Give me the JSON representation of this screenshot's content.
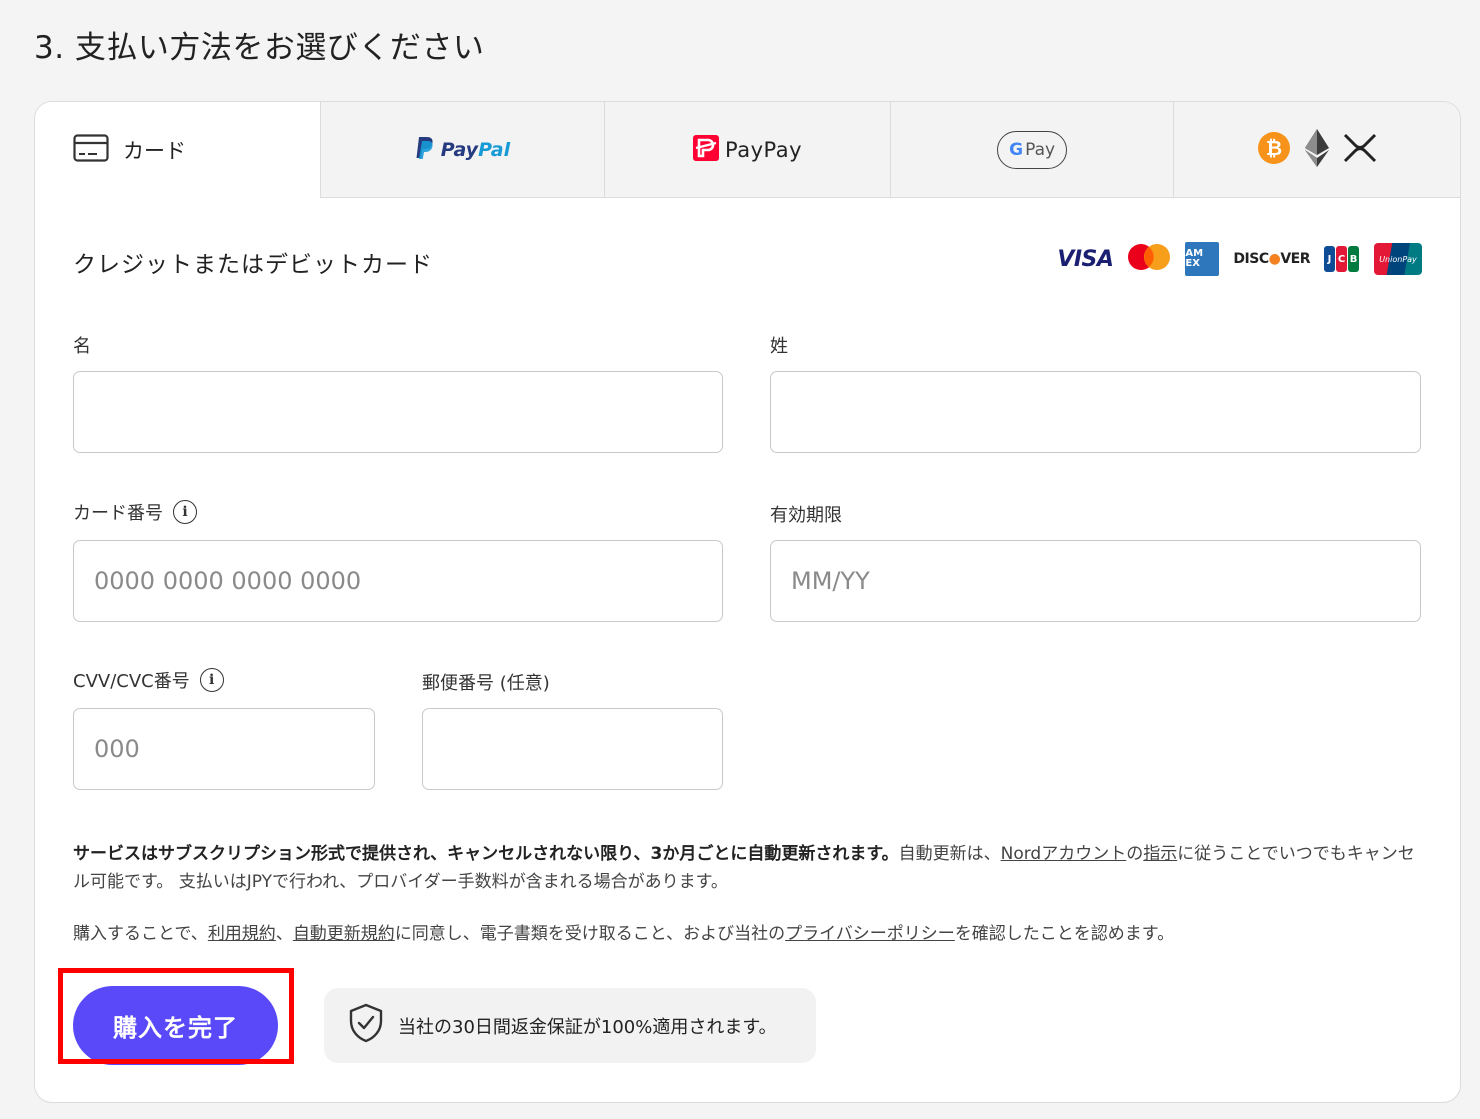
{
  "page": {
    "step_title": "3. 支払い方法をお選びください"
  },
  "tabs": {
    "card": {
      "label": "カード"
    },
    "paypal": {
      "label_a": "Pay",
      "label_b": "Pal"
    },
    "paypay": {
      "label": "PayPay"
    },
    "googlepay": {
      "g": "G",
      "label": "Pay"
    }
  },
  "card_section": {
    "title": "クレジットまたはデビットカード",
    "brands": {
      "visa": "VISA",
      "amex": "AM EX",
      "discover_a": "DISC",
      "discover_b": "VER",
      "jcb": [
        "J",
        "C",
        "B"
      ],
      "unionpay": "UnionPay"
    },
    "fields": {
      "first_name": {
        "label": "名",
        "value": "",
        "placeholder": ""
      },
      "last_name": {
        "label": "姓",
        "value": "",
        "placeholder": ""
      },
      "card_number": {
        "label": "カード番号",
        "placeholder": "0000 0000 0000 0000"
      },
      "expiry": {
        "label": "有効期限",
        "placeholder": "MM/YY"
      },
      "cvv": {
        "label": "CVV/CVC番号",
        "placeholder": "000"
      },
      "postal": {
        "label": "郵便番号 (任意)",
        "placeholder": ""
      }
    }
  },
  "terms": {
    "bold": "サービスはサブスクリプション形式で提供され、キャンセルされない限り、3か月ごとに自動更新されます。",
    "t1": "自動更新は、",
    "link_account": "Nordアカウント",
    "t2": "の",
    "link_instructions": "指示",
    "t3": "に従うことでいつでもキャンセル可能です。 支払いはJPYで行われ、プロバイダー手数料が含まれる場合があります。"
  },
  "consent": {
    "t1": "購入することで、",
    "link_terms": "利用規約",
    "t2": "、",
    "link_renewal": "自動更新規約",
    "t3": "に同意し、電子書類を受け取ること、および当社の",
    "link_privacy": "プライバシーポリシー",
    "t4": "を確認したことを認めます。"
  },
  "actions": {
    "buy_label": "購入を完了"
  },
  "guarantee": {
    "text": "当社の30日間返金保証が100%適用されます。"
  },
  "colors": {
    "primary": "#5a49f8",
    "highlight": "#ff0000"
  }
}
